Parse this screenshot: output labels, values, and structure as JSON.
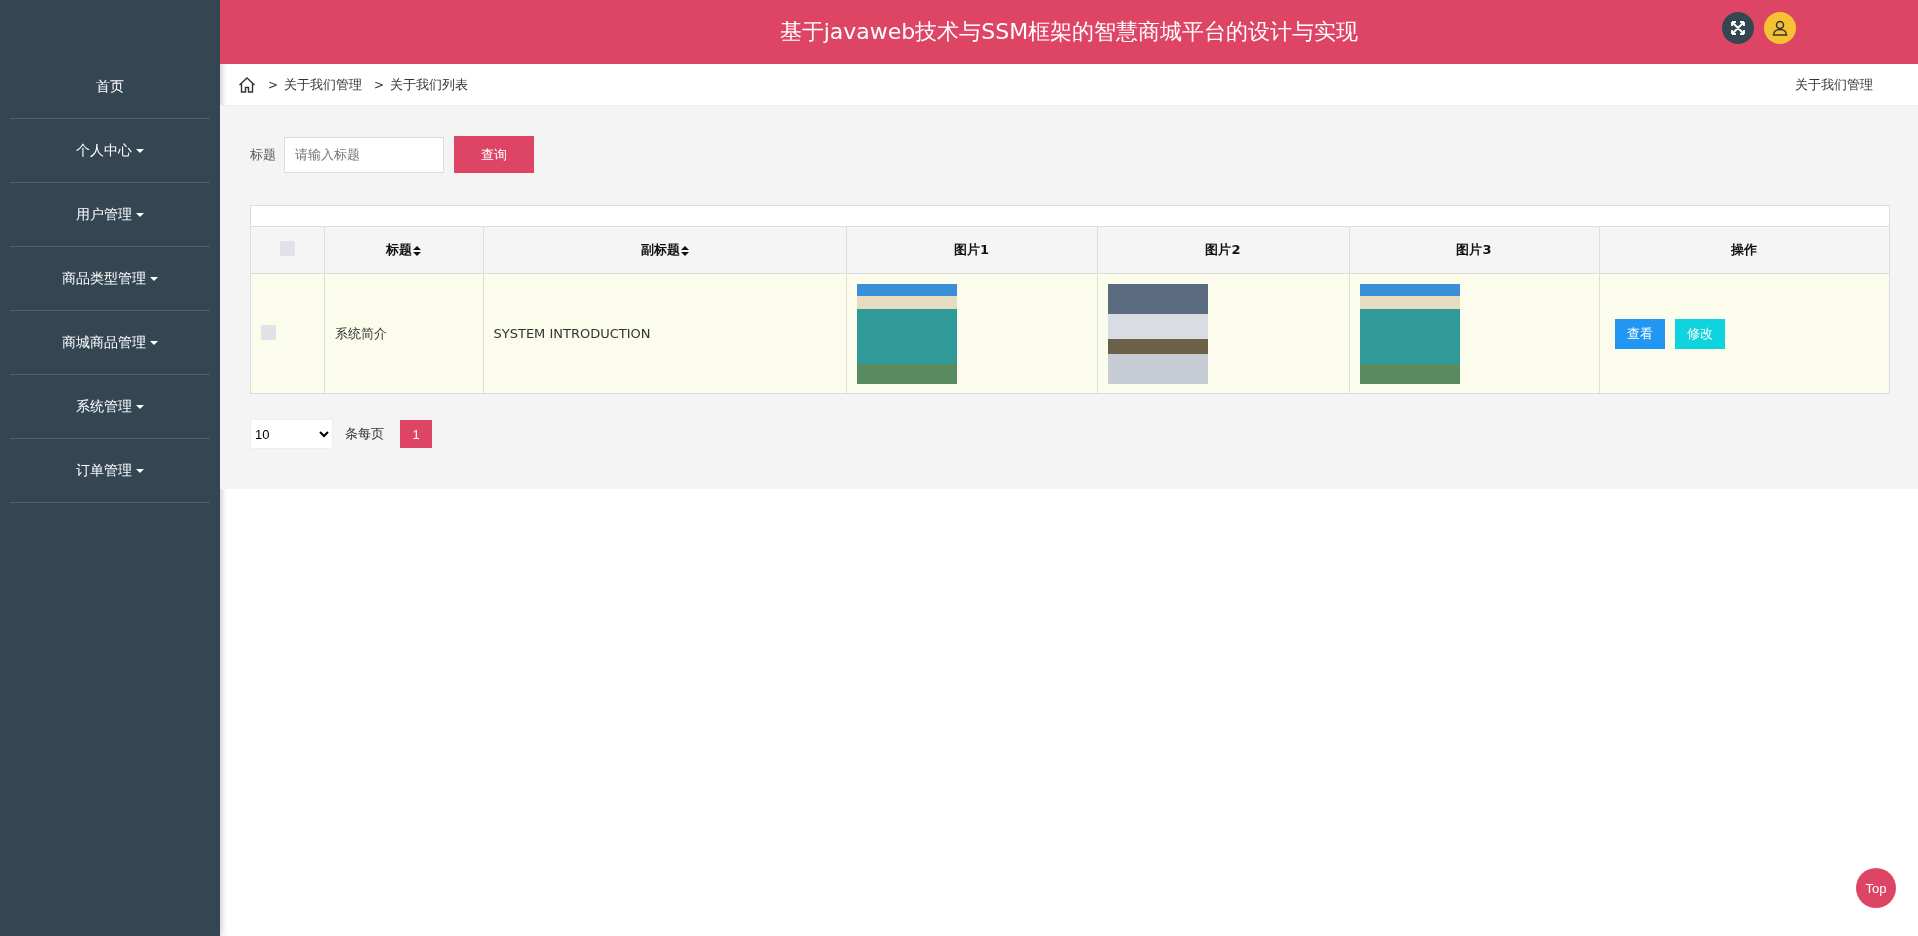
{
  "sidebar": {
    "items": [
      {
        "label": "首页",
        "has_submenu": false
      },
      {
        "label": "个人中心",
        "has_submenu": true
      },
      {
        "label": "用户管理",
        "has_submenu": true
      },
      {
        "label": "商品类型管理",
        "has_submenu": true
      },
      {
        "label": "商城商品管理",
        "has_submenu": true
      },
      {
        "label": "系统管理",
        "has_submenu": true
      },
      {
        "label": "订单管理",
        "has_submenu": true
      }
    ]
  },
  "header": {
    "title": "基于javaweb技术与SSM框架的智慧商城平台的设计与实现"
  },
  "breadcrumb": {
    "separator": ">",
    "items": [
      "关于我们管理",
      "关于我们列表"
    ],
    "page_title": "关于我们管理"
  },
  "search": {
    "label": "标题",
    "placeholder": "请输入标题",
    "button": "查询"
  },
  "table": {
    "select_all_checked": false,
    "columns": [
      {
        "label": "标题",
        "sortable": true
      },
      {
        "label": "副标题",
        "sortable": true
      },
      {
        "label": "图片1",
        "sortable": false
      },
      {
        "label": "图片2",
        "sortable": false
      },
      {
        "label": "图片3",
        "sortable": false
      },
      {
        "label": "操作",
        "sortable": false
      }
    ],
    "rows": [
      {
        "checked": false,
        "title": "系统简介",
        "subtitle": "SYSTEM INTRODUCTION",
        "actions": [
          {
            "label": "查看",
            "kind": "view"
          },
          {
            "label": "修改",
            "kind": "edit"
          }
        ]
      }
    ]
  },
  "pagination": {
    "page_size": "10",
    "per_page_label": "条每页",
    "pages": [
      {
        "label": "1",
        "selected": true
      }
    ]
  },
  "back_to_top": "Top"
}
